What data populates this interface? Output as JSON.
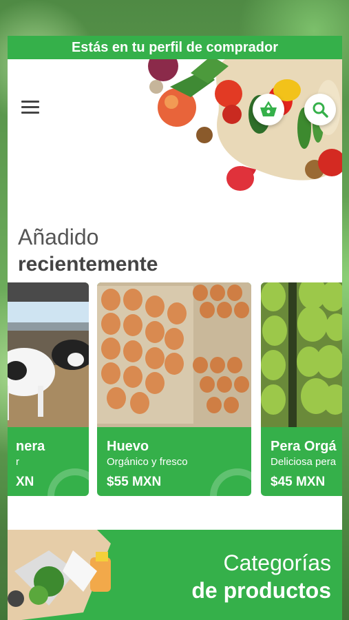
{
  "banner": {
    "text": "Estás en tu perfil de comprador"
  },
  "header": {
    "menu_icon": "hamburger-menu-icon",
    "basket_icon": "basket-icon",
    "search_icon": "search-icon"
  },
  "section": {
    "title_light": "Añadido",
    "title_bold": "recientemente"
  },
  "products": [
    {
      "name": "nera",
      "desc": "r",
      "price": "XN"
    },
    {
      "name": "Huevo",
      "desc": "Orgánico y fresco",
      "price": "$55 MXN"
    },
    {
      "name": "Pera Orgá",
      "desc": "Deliciosa pera",
      "price": "$45 MXN"
    }
  ],
  "categories": {
    "line1": "Categorías",
    "line2": "de productos"
  },
  "colors": {
    "accent": "#35b04a",
    "text_dark": "#444444"
  }
}
